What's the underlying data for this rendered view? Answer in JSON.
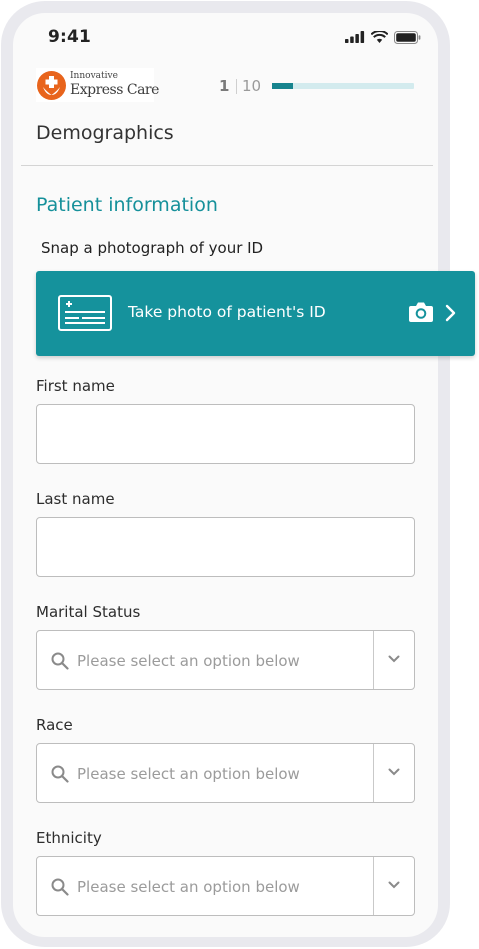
{
  "status_bar": {
    "time": "9:41",
    "icons": [
      "signal-bars-icon",
      "wifi-icon",
      "battery-icon"
    ]
  },
  "header": {
    "logo": {
      "small_text": "Innovative",
      "main_text": "Express Care",
      "icon": "cross-leaf-logo-icon",
      "colors": {
        "mark": "#e8641c"
      }
    },
    "step": {
      "current": "1",
      "total": "10",
      "progress": 0.15
    }
  },
  "page": {
    "title": "Demographics",
    "section_title": "Patient information",
    "snap_label": "Snap a photograph of your ID",
    "photo_button": {
      "label": "Take photo of patient's ID",
      "icons": [
        "id-card-icon",
        "camera-icon",
        "chevron-right-icon"
      ]
    }
  },
  "form": {
    "first_name": {
      "label": "First name",
      "value": "",
      "placeholder": ""
    },
    "last_name": {
      "label": "Last name",
      "value": "",
      "placeholder": ""
    },
    "marital_status": {
      "label": "Marital Status",
      "placeholder": "Please select an option below"
    },
    "race": {
      "label": "Race",
      "placeholder": "Please select an option below"
    },
    "ethnicity": {
      "label": "Ethnicity",
      "placeholder": "Please select an option below"
    }
  },
  "colors": {
    "accent": "#15929c",
    "progress_track": "#d3ebee",
    "progress_fill": "#17848e",
    "brand_orange": "#e8641c"
  }
}
